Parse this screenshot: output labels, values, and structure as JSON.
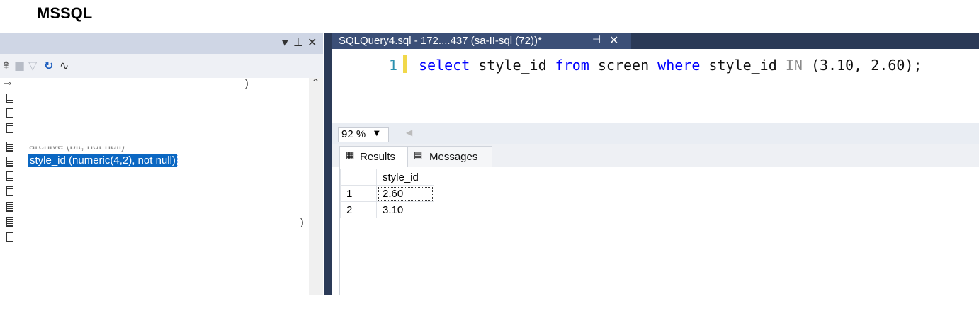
{
  "heading": "MSSQL",
  "object_explorer": {
    "toolbar_icons": [
      "connect-icon",
      "stop-icon",
      "filter-icon",
      "refresh-icon",
      "activity-monitor-icon"
    ],
    "tree_rows": [
      {
        "icon": "key-icon",
        "label": ""
      },
      {
        "icon": "column-icon",
        "label": ""
      },
      {
        "icon": "column-icon",
        "label": ""
      },
      {
        "icon": "column-icon",
        "label": ""
      },
      {
        "icon": "column-icon",
        "label": "archive (bit, not null)"
      },
      {
        "icon": "column-icon",
        "label": "style_id (numeric(4,2), not null)",
        "selected": true
      },
      {
        "icon": "column-icon",
        "label": ""
      },
      {
        "icon": "column-icon",
        "label": ""
      },
      {
        "icon": "column-icon",
        "label": ""
      },
      {
        "icon": "column-icon",
        "label": ""
      },
      {
        "icon": "column-icon",
        "label": ""
      }
    ],
    "key_row_paren": ")",
    "tail_paren": ")"
  },
  "query_tab": {
    "title": "SQLQuery4.sql - 172....437 (sa-II-sql (72))*",
    "pin_glyph": "⊣",
    "close_glyph": "✕"
  },
  "editor": {
    "line_number": "1",
    "tokens": [
      {
        "t": "select",
        "k": "kw"
      },
      {
        "t": " style_id ",
        "k": "tx"
      },
      {
        "t": "from",
        "k": "kw"
      },
      {
        "t": " screen ",
        "k": "tx"
      },
      {
        "t": "where",
        "k": "kw"
      },
      {
        "t": " style_id ",
        "k": "tx"
      },
      {
        "t": "IN",
        "k": "op"
      },
      {
        "t": " (3.10, 2.60);",
        "k": "tx"
      }
    ]
  },
  "zoom": {
    "value": "92 %"
  },
  "results_tabs": {
    "results": "Results",
    "messages": "Messages"
  },
  "grid": {
    "columns": [
      "style_id"
    ],
    "rows": [
      {
        "num": "1",
        "style_id": "2.60"
      },
      {
        "num": "2",
        "style_id": "3.10"
      }
    ]
  },
  "colors": {
    "tab_bg": "#3b4f77",
    "strip_bg": "#2b3a57",
    "selection": "#0b67c2",
    "keyword": "#0000ff",
    "line_number": "#2b91af"
  }
}
